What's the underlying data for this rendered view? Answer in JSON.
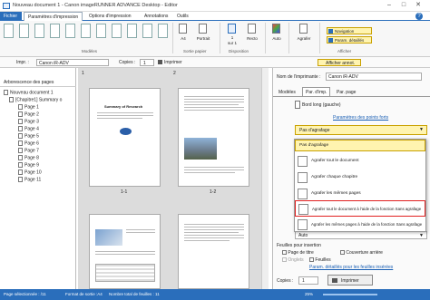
{
  "window": {
    "title": "Nouveau document 1 - Canon imageRUNNER ADVANCE Desktop - Editor"
  },
  "tabs": [
    "Fichier",
    "Paramètres d'impression",
    "Options d'impression",
    "Annotations",
    "Outils"
  ],
  "ribbon": {
    "group_modeles": "Modèles",
    "group_sortie": "Sortie papier",
    "group_disposition": "Disposition",
    "group_afficher": "Afficher",
    "paper_size": "A4",
    "orientation": "Portrait",
    "one_per": "1",
    "on": "sur 1",
    "recto": "Recto",
    "auto": "Auto",
    "agrafer": "Agrafer",
    "navigation": "Navigation",
    "param_details": "Param. détaillés"
  },
  "toolbar2": {
    "printer_label": "Impr. :",
    "printer_value": "Canon iR-ADV",
    "copies_label": "Copies :",
    "copies_value": "1",
    "print_label": "Imprimer",
    "show_annot": "Afficher annot."
  },
  "sidebar": {
    "header": "Arborescence des pages",
    "doc": "Nouveau document 1",
    "chapter": "[Chapitre1] Summary o",
    "pages": [
      "Page 1",
      "Page 2",
      "Page 3",
      "Page 4",
      "Page 5",
      "Page 6",
      "Page 7",
      "Page 8",
      "Page 9",
      "Page 10",
      "Page 11"
    ]
  },
  "center": {
    "sheet_nums": [
      "1",
      "2"
    ],
    "page_labels": [
      "1-1",
      "1-2"
    ],
    "page1_title": "Summary of Research"
  },
  "right": {
    "printer_name_label": "Nom de l'imprimante :",
    "printer_name_value": "Canon iR-ADV",
    "tabs": [
      "Modèles",
      "Par. d'imp.",
      "Par. page"
    ],
    "binding": "Bord long (gauche)",
    "finishing_link": "Paramètres des points forts",
    "staple_select": "Pas d'agrafage",
    "auto_select": "Auto",
    "insert_sheets": "Feuilles pour insertion",
    "cover": "Page de titre",
    "back_cover": "Couverture arrière",
    "tabs_opt": "Onglets",
    "sheets_opt": "Feuilles",
    "detailed_link": "Param. détaillés pour les feuilles insérées",
    "copies_label": "Copies :",
    "copies_value": "1",
    "print_button": "Imprimer"
  },
  "dropdown": {
    "items": [
      "Pas d'agrafage",
      "Agrafer tout le document",
      "Agrafer chaque chapitre",
      "Agrafer les mêmes pages",
      "Agrafer tout le document à l'aide de la fonction Sans agrafage",
      "Agrafer les mêmes pages à l'aide de la fonction Sans agrafage"
    ]
  },
  "status": {
    "selected": "Page sélectionnée : /11",
    "format": "Format de sortie :A4",
    "total": "Nombre total de feuilles : 11",
    "zoom": "25%"
  }
}
